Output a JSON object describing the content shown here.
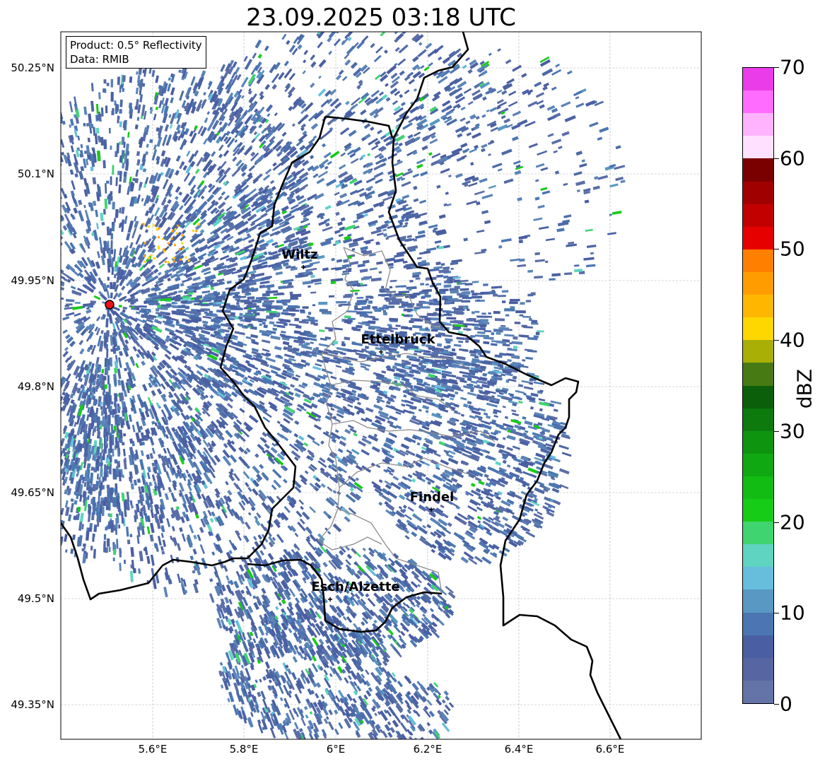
{
  "title": "23.09.2025 03:18 UTC",
  "info": {
    "line1": "Product: 0.5° Reflectivity",
    "line2": "Data: RMIB"
  },
  "lat_labels": [
    "50.25°N",
    "50.1°N",
    "49.95°N",
    "49.8°N",
    "49.65°N",
    "49.5°N",
    "49.35°N"
  ],
  "lon_labels": [
    "5.6°E",
    "5.8°E",
    "6°E",
    "6.2°E",
    "6.4°E",
    "6.6°E"
  ],
  "cities": [
    {
      "name": "Wiltz",
      "lat": 49.968,
      "lon": 5.932
    },
    {
      "name": "Ettelbruck",
      "lat": 49.848,
      "lon": 6.104
    },
    {
      "name": "Findel",
      "lat": 49.627,
      "lon": 6.208
    },
    {
      "name": "Esch/Alzette",
      "lat": 49.499,
      "lon": 5.985
    }
  ],
  "radar_site": {
    "lat": 49.914,
    "lon": 5.505,
    "color": "#e8121b"
  },
  "colorbar": {
    "label": "dBZ",
    "ticks": [
      "0",
      "10",
      "20",
      "30",
      "40",
      "50",
      "60",
      "70"
    ],
    "range": [
      0,
      70
    ],
    "step": 2.5,
    "colors": [
      "#6473a8",
      "#5766a2",
      "#4a5ea2",
      "#4b76b2",
      "#5898c2",
      "#66bedc",
      "#5fd4c1",
      "#3fd46f",
      "#17cc17",
      "#12bc12",
      "#0fa812",
      "#0e940f",
      "#0c7a0d",
      "#0b5f0b",
      "#477a12",
      "#aaaf06",
      "#ffd700",
      "#ffb600",
      "#ff9d00",
      "#ff8000",
      "#e60000",
      "#c20000",
      "#a10000",
      "#7a0000",
      "#ffe1ff",
      "#ffb3ff",
      "#ff6cff",
      "#eb3cea"
    ]
  },
  "map_extent": {
    "lon": [
      5.4,
      6.8
    ],
    "lat": [
      49.3,
      50.3
    ]
  }
}
